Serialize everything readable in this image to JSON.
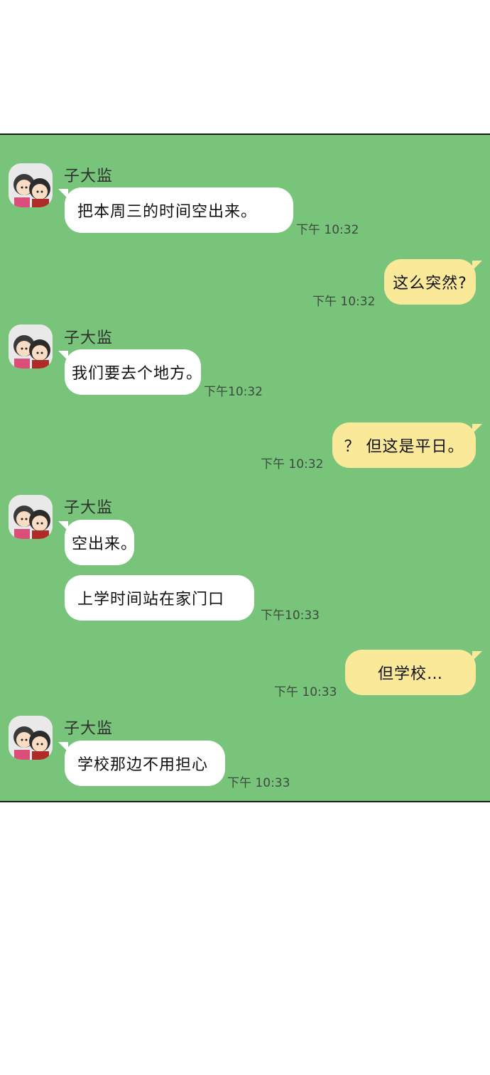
{
  "chat": {
    "messages": [
      {
        "sender": "子大监",
        "text": "把本周三的时间空出来。",
        "time": "下午 10:32"
      },
      {
        "text": "这么突然?",
        "time": "下午 10:32"
      },
      {
        "sender": "子大监",
        "text": "我们要去个地方。",
        "time": "下午10:32"
      },
      {
        "text": "？ 但这是平日。",
        "time": "下午 10:32"
      },
      {
        "sender": "子大监",
        "text": "空出来。"
      },
      {
        "text": "上学时间站在家门口",
        "time": "下午10:33"
      },
      {
        "text": "但学校…",
        "time": "下午 10:33"
      },
      {
        "sender": "子大监",
        "text": "学校那边不用担心",
        "time": "下午 10:33"
      }
    ]
  },
  "colors": {
    "chat_background": "#77c47a",
    "incoming_bubble": "#ffffff",
    "outgoing_bubble": "#fbe99a"
  },
  "icons": {
    "avatar": "contact-avatar-icon"
  }
}
